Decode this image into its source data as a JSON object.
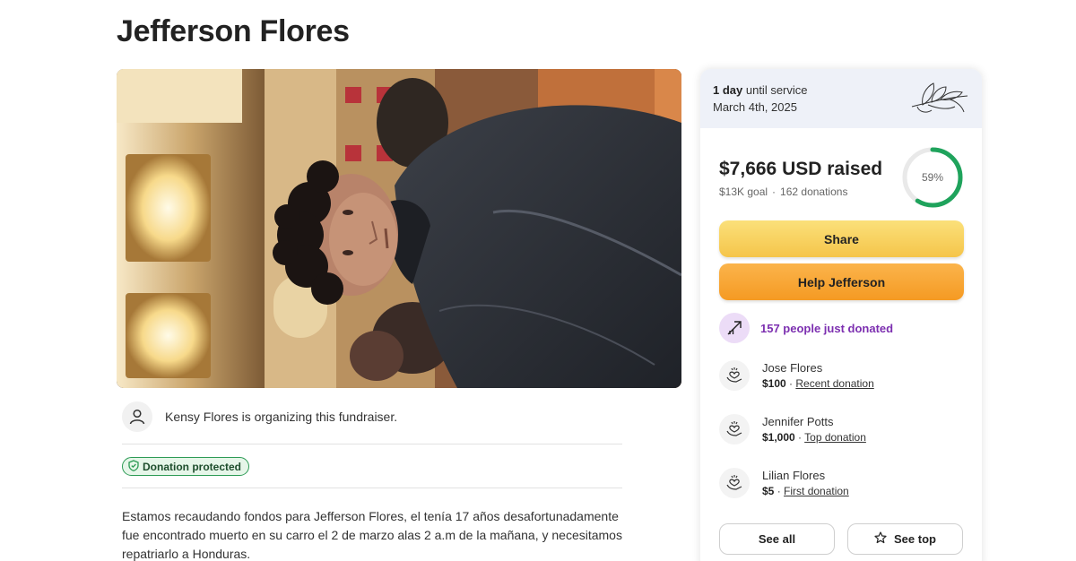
{
  "page": {
    "title": "Jefferson Flores"
  },
  "organizer": {
    "text": "Kensy Flores is organizing this fundraiser."
  },
  "badge": {
    "protected": "Donation protected"
  },
  "story": {
    "text": "Estamos recaudando fondos para Jefferson Flores, el tenía 17 años desafortunadamente fue encontrado muerto en su carro el 2 de marzo alas 2 a.m de la mañana, y necesitamos repatriarlo a Honduras."
  },
  "card": {
    "countdown_value": "1 day",
    "countdown_suffix": " until service",
    "service_date": "March 4th, 2025",
    "raised": "$7,666 USD raised",
    "goal": "$13K goal",
    "separator": "·",
    "donations": "162 donations",
    "progress_percent": 59,
    "progress_label": "59%",
    "share_label": "Share",
    "help_label": "Help Jefferson",
    "trend_text": "157 people just donated",
    "donors": [
      {
        "name": "Jose Flores",
        "amount": "$100",
        "tag": "Recent donation"
      },
      {
        "name": "Jennifer Potts",
        "amount": "$1,000",
        "tag": "Top donation"
      },
      {
        "name": "Lilian Flores",
        "amount": "$5",
        "tag": "First donation"
      }
    ],
    "see_all_label": "See all",
    "see_top_label": "See top"
  },
  "colors": {
    "progress": "#1fa35c",
    "progress_track": "#e9e9e9",
    "share": "#f5c54a",
    "help": "#f59a23",
    "trend_text": "#7c2fb0",
    "protected_border": "#2d9b55"
  },
  "icons": {
    "organizer": "person-icon",
    "protected": "shield-check-icon",
    "flower": "flower-icon",
    "trend": "trending-up-icon",
    "donor": "heart-hands-icon",
    "see_top": "star-icon"
  }
}
